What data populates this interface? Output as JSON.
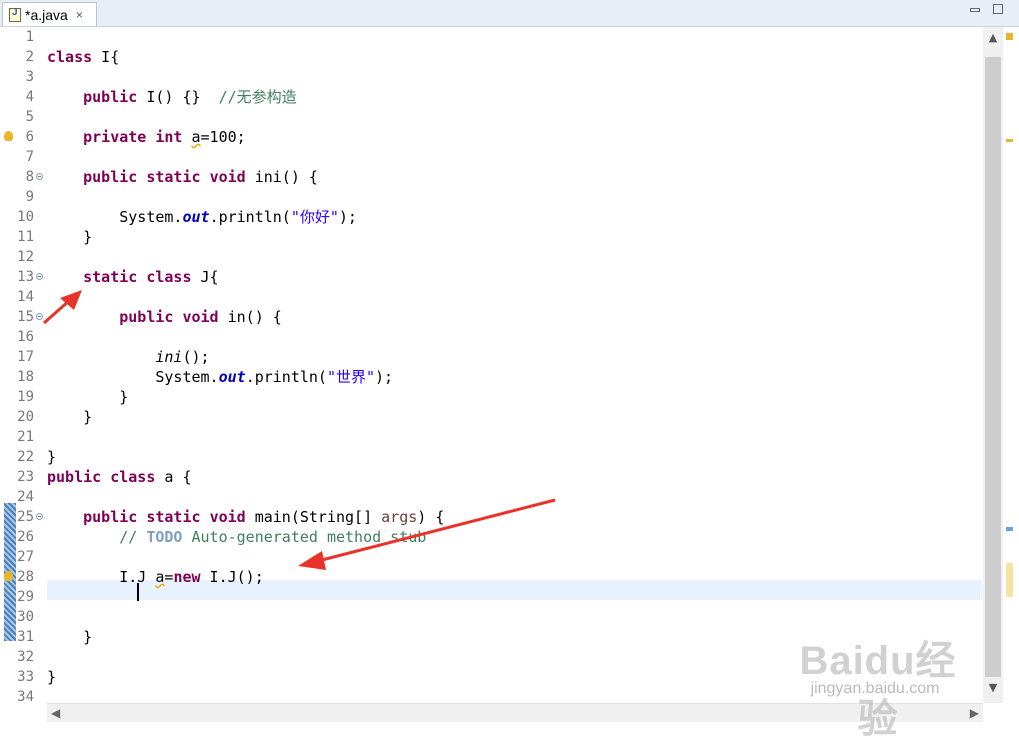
{
  "tab": {
    "title": "*a.java",
    "close_glyph": "×"
  },
  "code_lines": [
    {
      "n": "1"
    },
    {
      "n": "2"
    },
    {
      "n": "3"
    },
    {
      "n": "4"
    },
    {
      "n": "5"
    },
    {
      "n": "6"
    },
    {
      "n": "7"
    },
    {
      "n": "8"
    },
    {
      "n": "9"
    },
    {
      "n": "10"
    },
    {
      "n": "11"
    },
    {
      "n": "12"
    },
    {
      "n": "13"
    },
    {
      "n": "14"
    },
    {
      "n": "15"
    },
    {
      "n": "16"
    },
    {
      "n": "17"
    },
    {
      "n": "18"
    },
    {
      "n": "19"
    },
    {
      "n": "20"
    },
    {
      "n": "21"
    },
    {
      "n": "22"
    },
    {
      "n": "23"
    },
    {
      "n": "24"
    },
    {
      "n": "25"
    },
    {
      "n": "26"
    },
    {
      "n": "27"
    },
    {
      "n": "28"
    },
    {
      "n": "29"
    },
    {
      "n": "30"
    },
    {
      "n": "31"
    },
    {
      "n": "32"
    },
    {
      "n": "33"
    },
    {
      "n": "34"
    }
  ],
  "tokens": {
    "l2a": "class",
    "l2b": " I{",
    "l4a": "public",
    "l4b": " I() {}  ",
    "l4c": "//无参构造",
    "l6a": "private",
    "l6b": "int",
    "l6c": "a",
    "l6d": "=100;",
    "l8a": "public",
    "l8b": "static",
    "l8c": "void",
    "l8d": " ini() {",
    "l10a": "System.",
    "l10b": "out",
    "l10c": ".println(",
    "l10d": "\"你好\"",
    "l10e": ");",
    "l11": "}",
    "l13a": "static",
    "l13b": "class",
    "l13c": " J{",
    "l15a": "public",
    "l15b": "void",
    "l15c": " in() {",
    "l17a": "ini",
    "l17b": "();",
    "l18a": "System.",
    "l18b": "out",
    "l18c": ".println(",
    "l18d": "\"世界\"",
    "l18e": ");",
    "l19": "}",
    "l20": "}",
    "l22": "}",
    "l23a": "public",
    "l23b": "class",
    "l23c": " a {",
    "l25a": "public",
    "l25b": "static",
    "l25c": "void",
    "l25d": " main(String[] ",
    "l25e": "args",
    "l25f": ") {",
    "l26a": "// ",
    "l26b": "TODO",
    "l26c": " Auto-generated method stub",
    "l28a": "I.J ",
    "l28b": "a",
    "l28c": "=",
    "l28d": "new",
    "l28e": " I.J();",
    "l31": "}",
    "l33": "}"
  },
  "watermark": {
    "logo": "Baidu经验",
    "url": "jingyan.baidu.com"
  },
  "colors": {
    "keyword": "#7f0055",
    "comment": "#3f7f5f",
    "string": "#2a00ff",
    "field": "#0000c0",
    "arrow": "#e8332a",
    "current_line": "#e8f2fe"
  },
  "icons": {
    "file": "java-file-icon",
    "close": "close-tab-icon",
    "minimize": "minimize-icon",
    "maximize": "maximize-icon",
    "warning": "warning-icon"
  }
}
